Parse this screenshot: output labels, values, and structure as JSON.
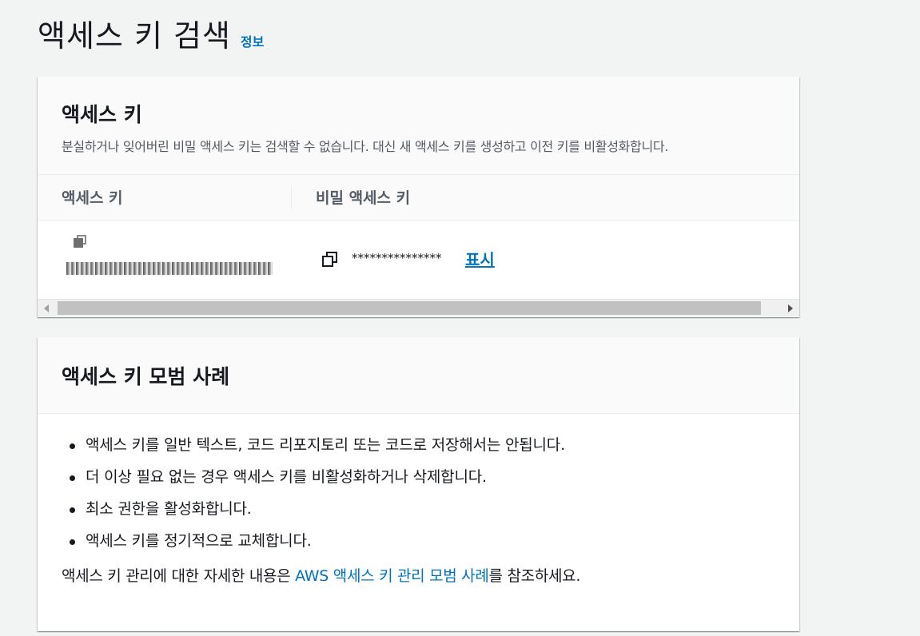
{
  "header": {
    "title": "액세스 키 검색",
    "info_link": "정보"
  },
  "access_key_card": {
    "title": "액세스 키",
    "description": "분실하거나 잊어버린 비밀 액세스 키는 검색할 수 없습니다. 대신 새 액세스 키를 생성하고 이전 키를 비활성화합니다.",
    "columns": [
      "액세스 키",
      "비밀 액세스 키"
    ],
    "row": {
      "secret_masked": "***************",
      "show_label": "표시"
    }
  },
  "best_practices_card": {
    "title": "액세스 키 모범 사례",
    "items": [
      "액세스 키를 일반 텍스트, 코드 리포지토리 또는 코드로 저장해서는 안됩니다.",
      "더 이상 필요 없는 경우 액세스 키를 비활성화하거나 삭제합니다.",
      "최소 권한을 활성화합니다.",
      "액세스 키를 정기적으로 교체합니다."
    ],
    "note_prefix": "액세스 키 관리에 대한 자세한 내용은 ",
    "note_link": "AWS 액세스 키 관리 모범 사례",
    "note_suffix": "를 참조하세요."
  },
  "colors": {
    "link": "#0073bb",
    "background": "#f2f3f3",
    "text": "#16191f",
    "muted": "#545b64"
  },
  "icons": [
    "copy-icon"
  ]
}
